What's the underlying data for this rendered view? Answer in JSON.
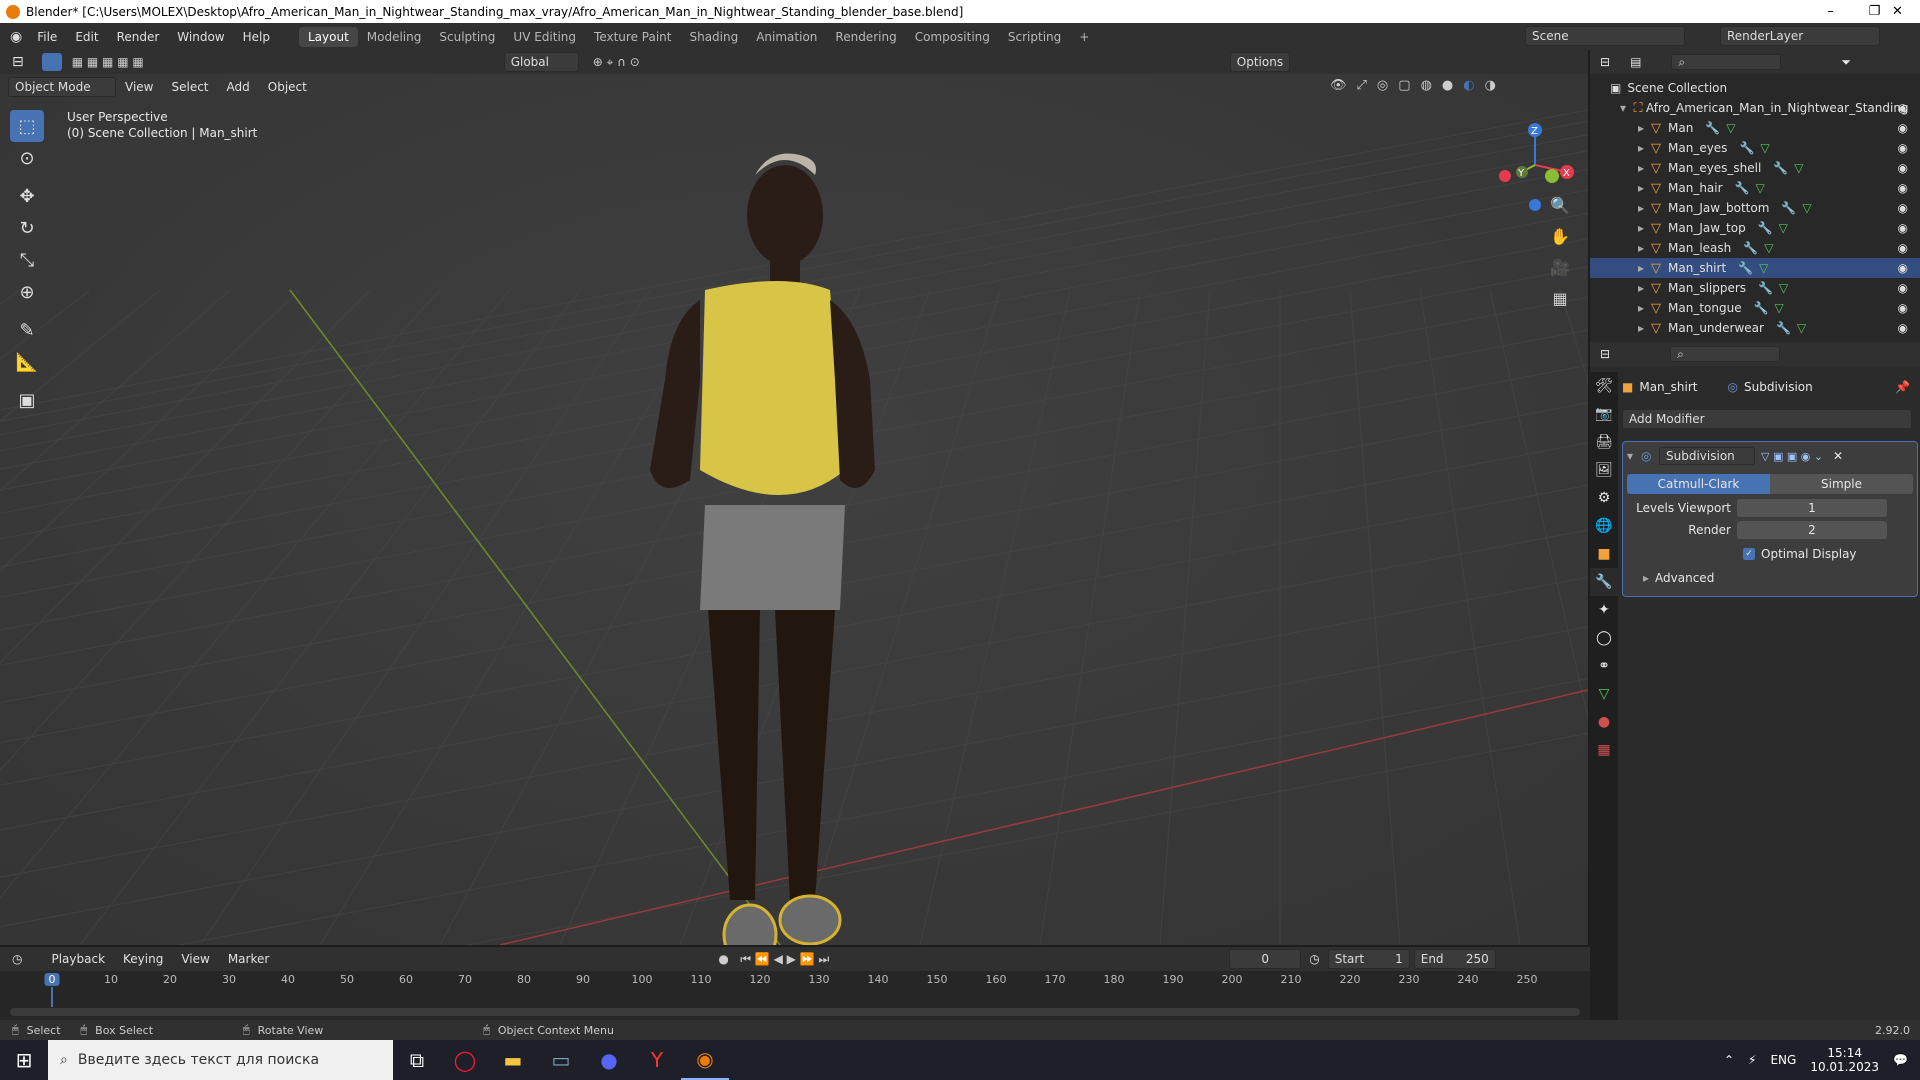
{
  "window": {
    "title": "Blender* [C:\\Users\\MOLEX\\Desktop\\Afro_American_Man_in_Nightwear_Standing_max_vray/Afro_American_Man_in_Nightwear_Standing_blender_base.blend]",
    "minimize": "–",
    "maximize": "❐",
    "close": "✕"
  },
  "menu": [
    "File",
    "Edit",
    "Render",
    "Window",
    "Help"
  ],
  "workspaces": [
    "Layout",
    "Modeling",
    "Sculpting",
    "UV Editing",
    "Texture Paint",
    "Shading",
    "Animation",
    "Rendering",
    "Compositing",
    "Scripting"
  ],
  "active_workspace": "Layout",
  "scene": "Scene",
  "view_layer": "RenderLayer",
  "toolbar": {
    "transform_orientation": "Global",
    "options": "Options"
  },
  "viewport_header": {
    "mode": "Object Mode",
    "menus": [
      "View",
      "Select",
      "Add",
      "Object"
    ]
  },
  "viewport": {
    "perspective": "User Perspective",
    "collection_info": "(0) Scene Collection | Man_shirt"
  },
  "gizmo": {
    "x": "X",
    "y": "Y",
    "z": "Z"
  },
  "outliner": {
    "root": "Scene Collection",
    "collection": "Afro_American_Man_in_Nightwear_Standing",
    "objects": [
      "Man",
      "Man_eyes",
      "Man_eyes_shell",
      "Man_hair",
      "Man_Jaw_bottom",
      "Man_Jaw_top",
      "Man_leash",
      "Man_shirt",
      "Man_slippers",
      "Man_tongue",
      "Man_underwear"
    ],
    "active": "Man_shirt"
  },
  "properties": {
    "object": "Man_shirt",
    "modifier_context": "Subdivision",
    "add_modifier": "Add Modifier",
    "modifier_name": "Subdivision",
    "mode_a": "Catmull-Clark",
    "mode_b": "Simple",
    "levels_viewport_label": "Levels Viewport",
    "levels_viewport": "1",
    "render_label": "Render",
    "render": "2",
    "optimal_display": "Optimal Display",
    "advanced": "Advanced"
  },
  "timeline": {
    "menus": [
      "Playback",
      "Keying",
      "View",
      "Marker"
    ],
    "current_frame": "0",
    "start_label": "Start",
    "start": "1",
    "end_label": "End",
    "end": "250",
    "ticks": [
      "0",
      "10",
      "20",
      "30",
      "40",
      "50",
      "60",
      "70",
      "80",
      "90",
      "100",
      "110",
      "120",
      "130",
      "140",
      "150",
      "160",
      "170",
      "180",
      "190",
      "200",
      "210",
      "220",
      "230",
      "240",
      "250"
    ]
  },
  "status": {
    "select": "Select",
    "box_select": "Box Select",
    "rotate_view": "Rotate View",
    "context_menu": "Object Context Menu",
    "version": "2.92.0"
  },
  "taskbar": {
    "search_placeholder": "Введите здесь текст для поиска",
    "lang": "ENG",
    "time": "15:14",
    "date": "10.01.2023"
  },
  "colors": {
    "accent": "#4772b3",
    "x_axis": "#e63b4f",
    "y_axis": "#8bbd34",
    "z_axis": "#3a78d8",
    "object_orange": "#f2a23b"
  }
}
